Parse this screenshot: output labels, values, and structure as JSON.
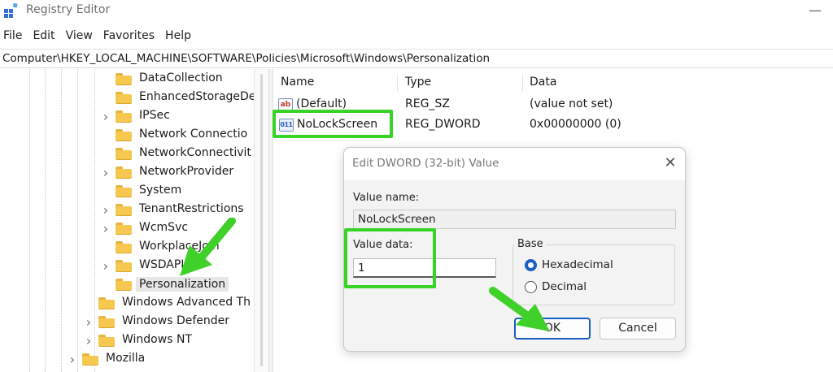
{
  "window": {
    "title": "Registry Editor",
    "minimize_glyph": "—"
  },
  "menu": [
    "File",
    "Edit",
    "View",
    "Favorites",
    "Help"
  ],
  "address": "Computer\\HKEY_LOCAL_MACHINE\\SOFTWARE\\Policies\\Microsoft\\Windows\\Personalization",
  "tree": [
    {
      "label": "DataCollection",
      "expander": false
    },
    {
      "label": "EnhancedStorageDe",
      "expander": false
    },
    {
      "label": "IPSec",
      "expander": true
    },
    {
      "label": "Network Connectio",
      "expander": false
    },
    {
      "label": "NetworkConnectivit",
      "expander": false
    },
    {
      "label": "NetworkProvider",
      "expander": true
    },
    {
      "label": "System",
      "expander": false
    },
    {
      "label": "TenantRestrictions",
      "expander": true
    },
    {
      "label": "WcmSvc",
      "expander": true
    },
    {
      "label": "WorkplaceJoin",
      "expander": false
    },
    {
      "label": "WSDAPI",
      "expander": true
    },
    {
      "label": "Personalization",
      "expander": false,
      "selected": true
    },
    {
      "label": "Windows Advanced Th",
      "expander": false
    },
    {
      "label": "Windows Defender",
      "expander": true
    },
    {
      "label": "Windows NT",
      "expander": true
    },
    {
      "label": "Mozilla",
      "expander": true
    }
  ],
  "list": {
    "columns": [
      "Name",
      "Type",
      "Data"
    ],
    "rows": [
      {
        "name": "(Default)",
        "type": "REG_SZ",
        "data": "(value not set)",
        "icon": "string-value-icon",
        "icon_text": "ab"
      },
      {
        "name": "NoLockScreen",
        "type": "REG_DWORD",
        "data": "0x00000000 (0)",
        "icon": "binary-value-icon",
        "icon_text": "011"
      }
    ]
  },
  "dialog": {
    "title": "Edit DWORD (32-bit) Value",
    "close_glyph": "✕",
    "value_name_label": "Value name:",
    "value_name": "NoLockScreen",
    "value_data_label": "Value data:",
    "value_data": "1",
    "base_label": "Base",
    "base_options": [
      {
        "label": "Hexadecimal",
        "selected": true
      },
      {
        "label": "Decimal",
        "selected": false
      }
    ],
    "ok_label": "OK",
    "cancel_label": "Cancel"
  },
  "colors": {
    "highlight": "#37d325",
    "arrow": "#3fd12a",
    "folder": "#f7c84f",
    "accent": "#1a5fc4"
  }
}
